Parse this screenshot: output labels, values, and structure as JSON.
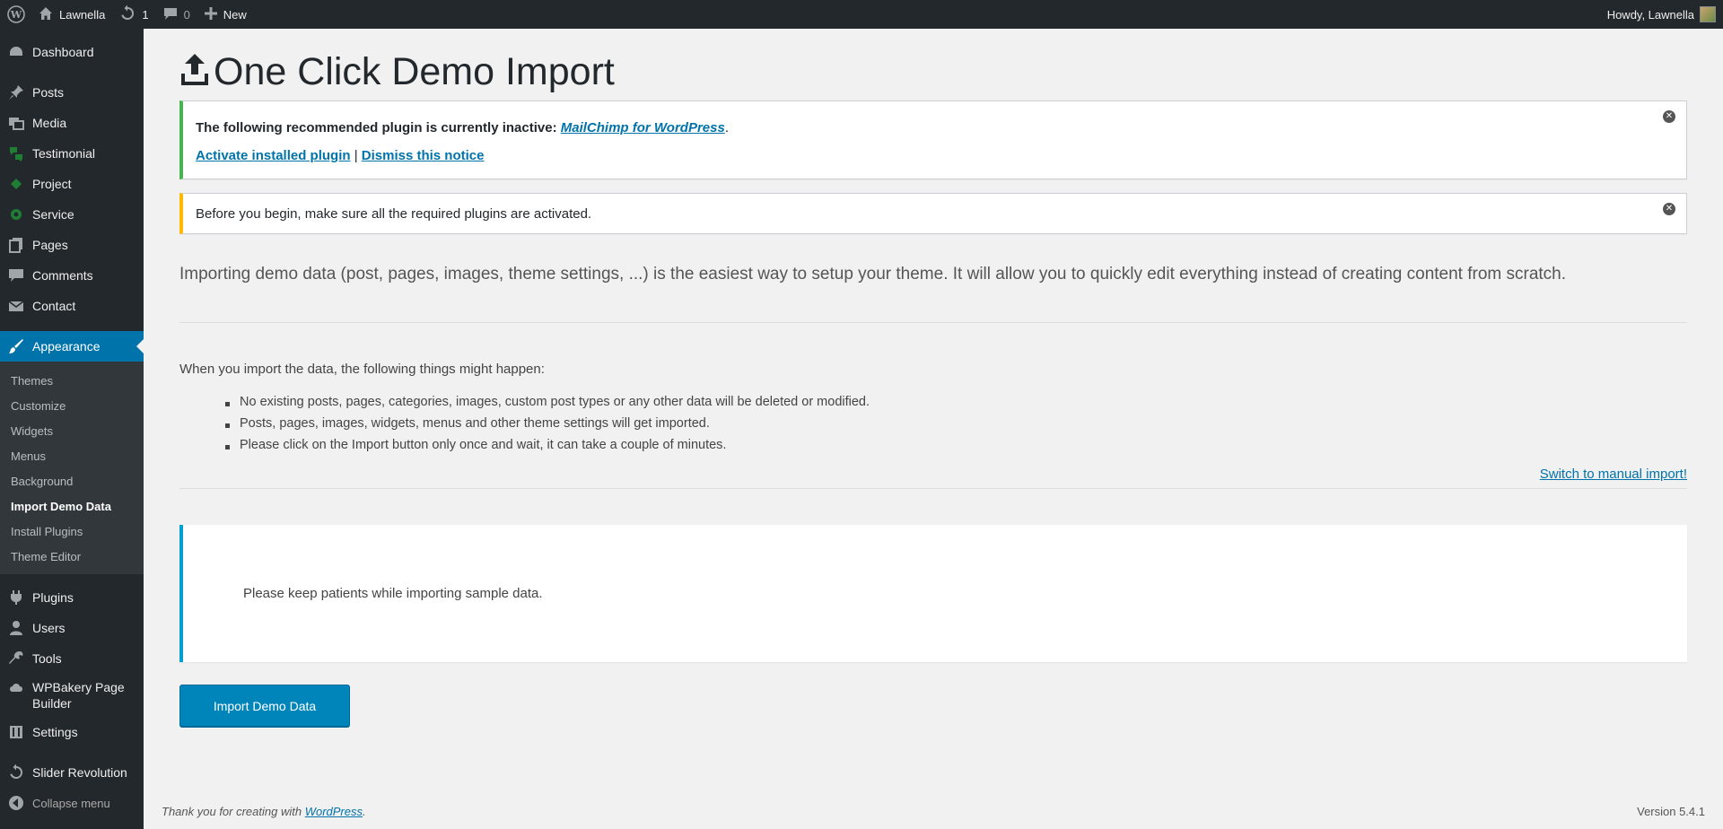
{
  "adminbar": {
    "site_name": "Lawnella",
    "updates_count": "1",
    "comments_count": "0",
    "new_label": "New",
    "howdy": "Howdy, Lawnella"
  },
  "sidebar": {
    "items_top": [
      {
        "label": "Dashboard",
        "icon": "dashboard-icon"
      },
      {
        "label": "Posts",
        "icon": "pin-icon"
      },
      {
        "label": "Media",
        "icon": "media-icon"
      },
      {
        "label": "Testimonial",
        "icon": "testimonial-icon"
      },
      {
        "label": "Project",
        "icon": "project-icon"
      },
      {
        "label": "Service",
        "icon": "service-icon"
      },
      {
        "label": "Pages",
        "icon": "pages-icon"
      },
      {
        "label": "Comments",
        "icon": "comments-icon"
      },
      {
        "label": "Contact",
        "icon": "mail-icon"
      },
      {
        "label": "Appearance",
        "icon": "brush-icon"
      }
    ],
    "submenu": [
      "Themes",
      "Customize",
      "Widgets",
      "Menus",
      "Background",
      "Import Demo Data",
      "Install Plugins",
      "Theme Editor"
    ],
    "items_bottom": [
      {
        "label": "Plugins",
        "icon": "plug-icon"
      },
      {
        "label": "Users",
        "icon": "users-icon"
      },
      {
        "label": "Tools",
        "icon": "wrench-icon"
      },
      {
        "label": "WPBakery Page Builder",
        "icon": "cloud-icon"
      },
      {
        "label": "Settings",
        "icon": "settings-icon"
      },
      {
        "label": "Slider Revolution",
        "icon": "refresh-icon"
      },
      {
        "label": "Collapse menu",
        "icon": "collapse-icon"
      }
    ]
  },
  "page": {
    "title": "One Click Demo Import",
    "notice_green": {
      "text": "The following recommended plugin is currently inactive: ",
      "plugin_link": "MailChimp for WordPress",
      "period": ".",
      "activate_link": "Activate installed plugin",
      "separator": " | ",
      "dismiss_link": "Dismiss this notice"
    },
    "notice_yellow": "Before you begin, make sure all the required plugins are activated.",
    "intro": "Importing demo data (post, pages, images, theme settings, ...) is the easiest way to setup your theme. It will allow you to quickly edit everything instead of creating content from scratch.",
    "happen_title": "When you import the data, the following things might happen:",
    "bullets": [
      "No existing posts, pages, categories, images, custom post types or any other data will be deleted or modified.",
      "Posts, pages, images, widgets, menus and other theme settings will get imported.",
      "Please click on the Import button only once and wait, it can take a couple of minutes."
    ],
    "manual_link": "Switch to manual import!",
    "progress_text": "Please keep patients while importing sample data.",
    "import_button": "Import Demo Data"
  },
  "footer": {
    "thanks": "Thank you for creating with ",
    "wp_link": "WordPress",
    "period": ".",
    "version": "Version 5.4.1"
  }
}
